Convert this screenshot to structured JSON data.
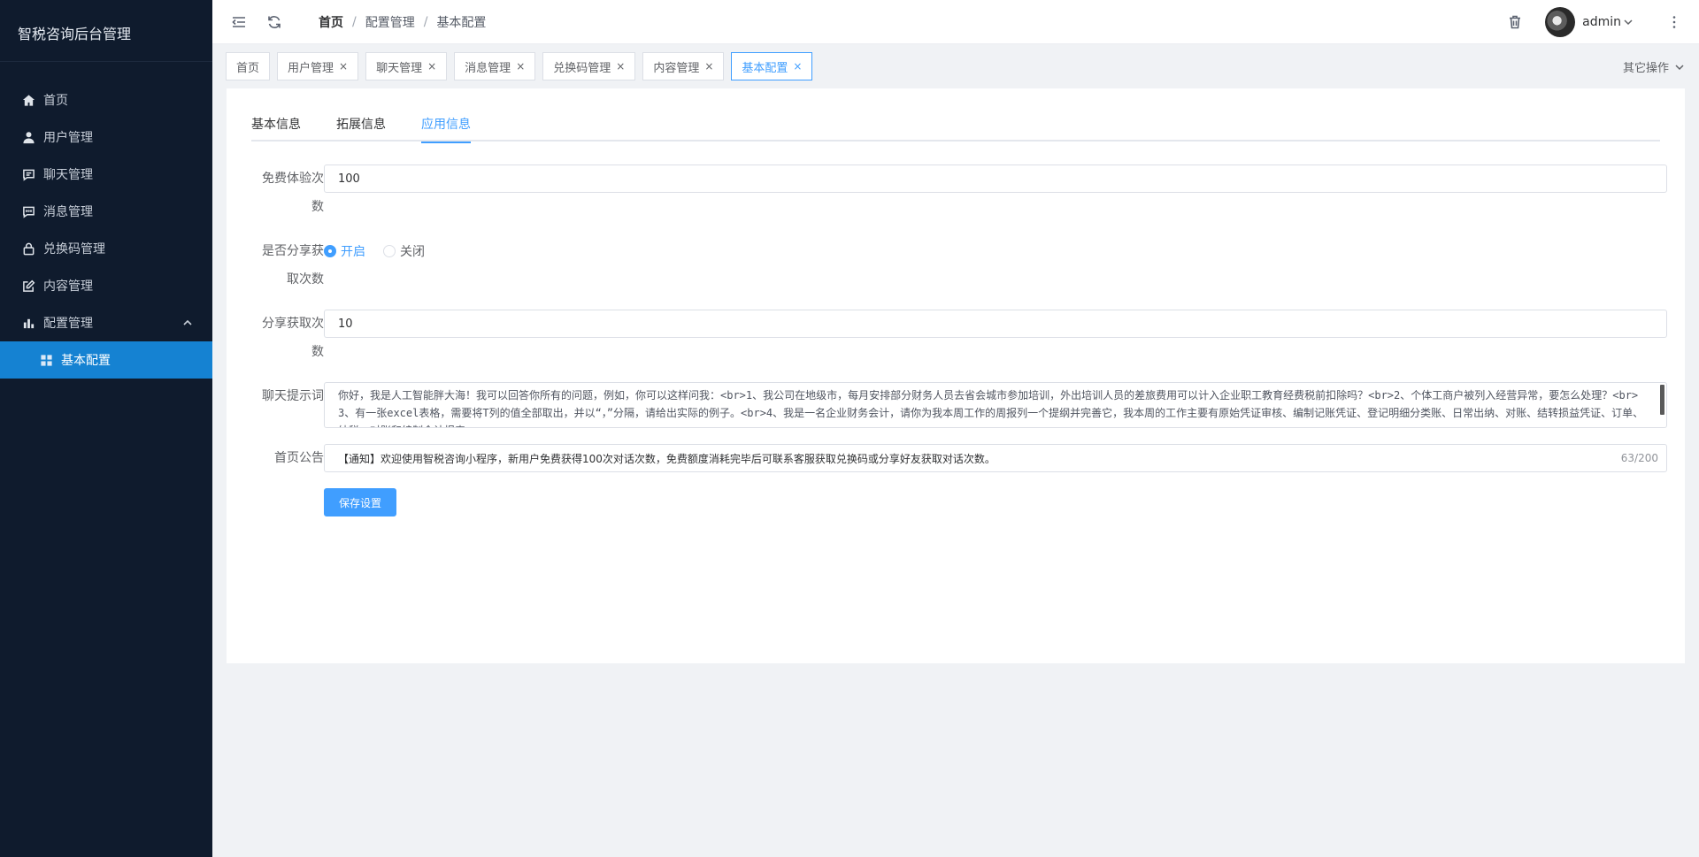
{
  "app": {
    "title": "智税咨询后台管理"
  },
  "sidebar": {
    "items": [
      {
        "label": "首页",
        "icon": "home-icon"
      },
      {
        "label": "用户管理",
        "icon": "user-icon"
      },
      {
        "label": "聊天管理",
        "icon": "chat-icon"
      },
      {
        "label": "消息管理",
        "icon": "message-icon"
      },
      {
        "label": "兑换码管理",
        "icon": "lock-icon"
      },
      {
        "label": "内容管理",
        "icon": "edit-icon"
      },
      {
        "label": "配置管理",
        "icon": "bar-chart-icon",
        "expanded": true
      },
      {
        "label": "基本配置",
        "icon": "grid-icon",
        "active": true
      }
    ]
  },
  "header": {
    "breadcrumb": [
      "首页",
      "配置管理",
      "基本配置"
    ],
    "user": "admin",
    "separator": "/"
  },
  "tags": {
    "items": [
      "首页",
      "用户管理",
      "聊天管理",
      "消息管理",
      "兑换码管理",
      "内容管理",
      "基本配置"
    ],
    "active_index": 6,
    "close_glyph": "×",
    "other_ops": "其它操作"
  },
  "tabs": {
    "items": [
      "基本信息",
      "拓展信息",
      "应用信息"
    ],
    "active_index": 2
  },
  "form": {
    "free_trial": {
      "label_line1": "免费体验次",
      "label_line2": "数",
      "value": "100"
    },
    "share_enable": {
      "label_line1": "是否分享获",
      "label_line2": "取次数",
      "options": [
        "开启",
        "关闭"
      ],
      "selected": "开启"
    },
    "share_count": {
      "label_line1": "分享获取次",
      "label_line2": "数",
      "value": "10"
    },
    "chat_prompt": {
      "label": "聊天提示词",
      "value": "你好，我是人工智能胖大海！我可以回答你所有的问题，例如，你可以这样问我：<br>1、我公司在地级市，每月安排部分财务人员去省会城市参加培训，外出培训人员的差旅费用可以计入企业职工教育经费税前扣除吗？<br>2、个体工商户被列入经营异常，要怎么处理？<br>3、有一张excel表格，需要将T列的值全部取出，并以“，”分隔，请给出实际的例子。<br>4、我是一名企业财务会计，请你为我本周工作的周报列一个提纲并完善它，我本周的工作主要有原始凭证审核、编制记账凭证、登记明细分类账、日常出纳、对账、结转损益凭证、订单、纳税、对账和编制会计报表"
    },
    "announcement": {
      "label": "首页公告",
      "value": "【通知】欢迎使用智税咨询小程序，新用户免费获得100次对话次数，免费额度消耗完毕后可联系客服获取兑换码或分享好友获取对话次数。",
      "counter": "63/200"
    },
    "save_label": "保存设置"
  },
  "colors": {
    "primary": "#409eff",
    "sidebar_bg": "#0f1b2d",
    "sidebar_active": "#1582d2"
  }
}
